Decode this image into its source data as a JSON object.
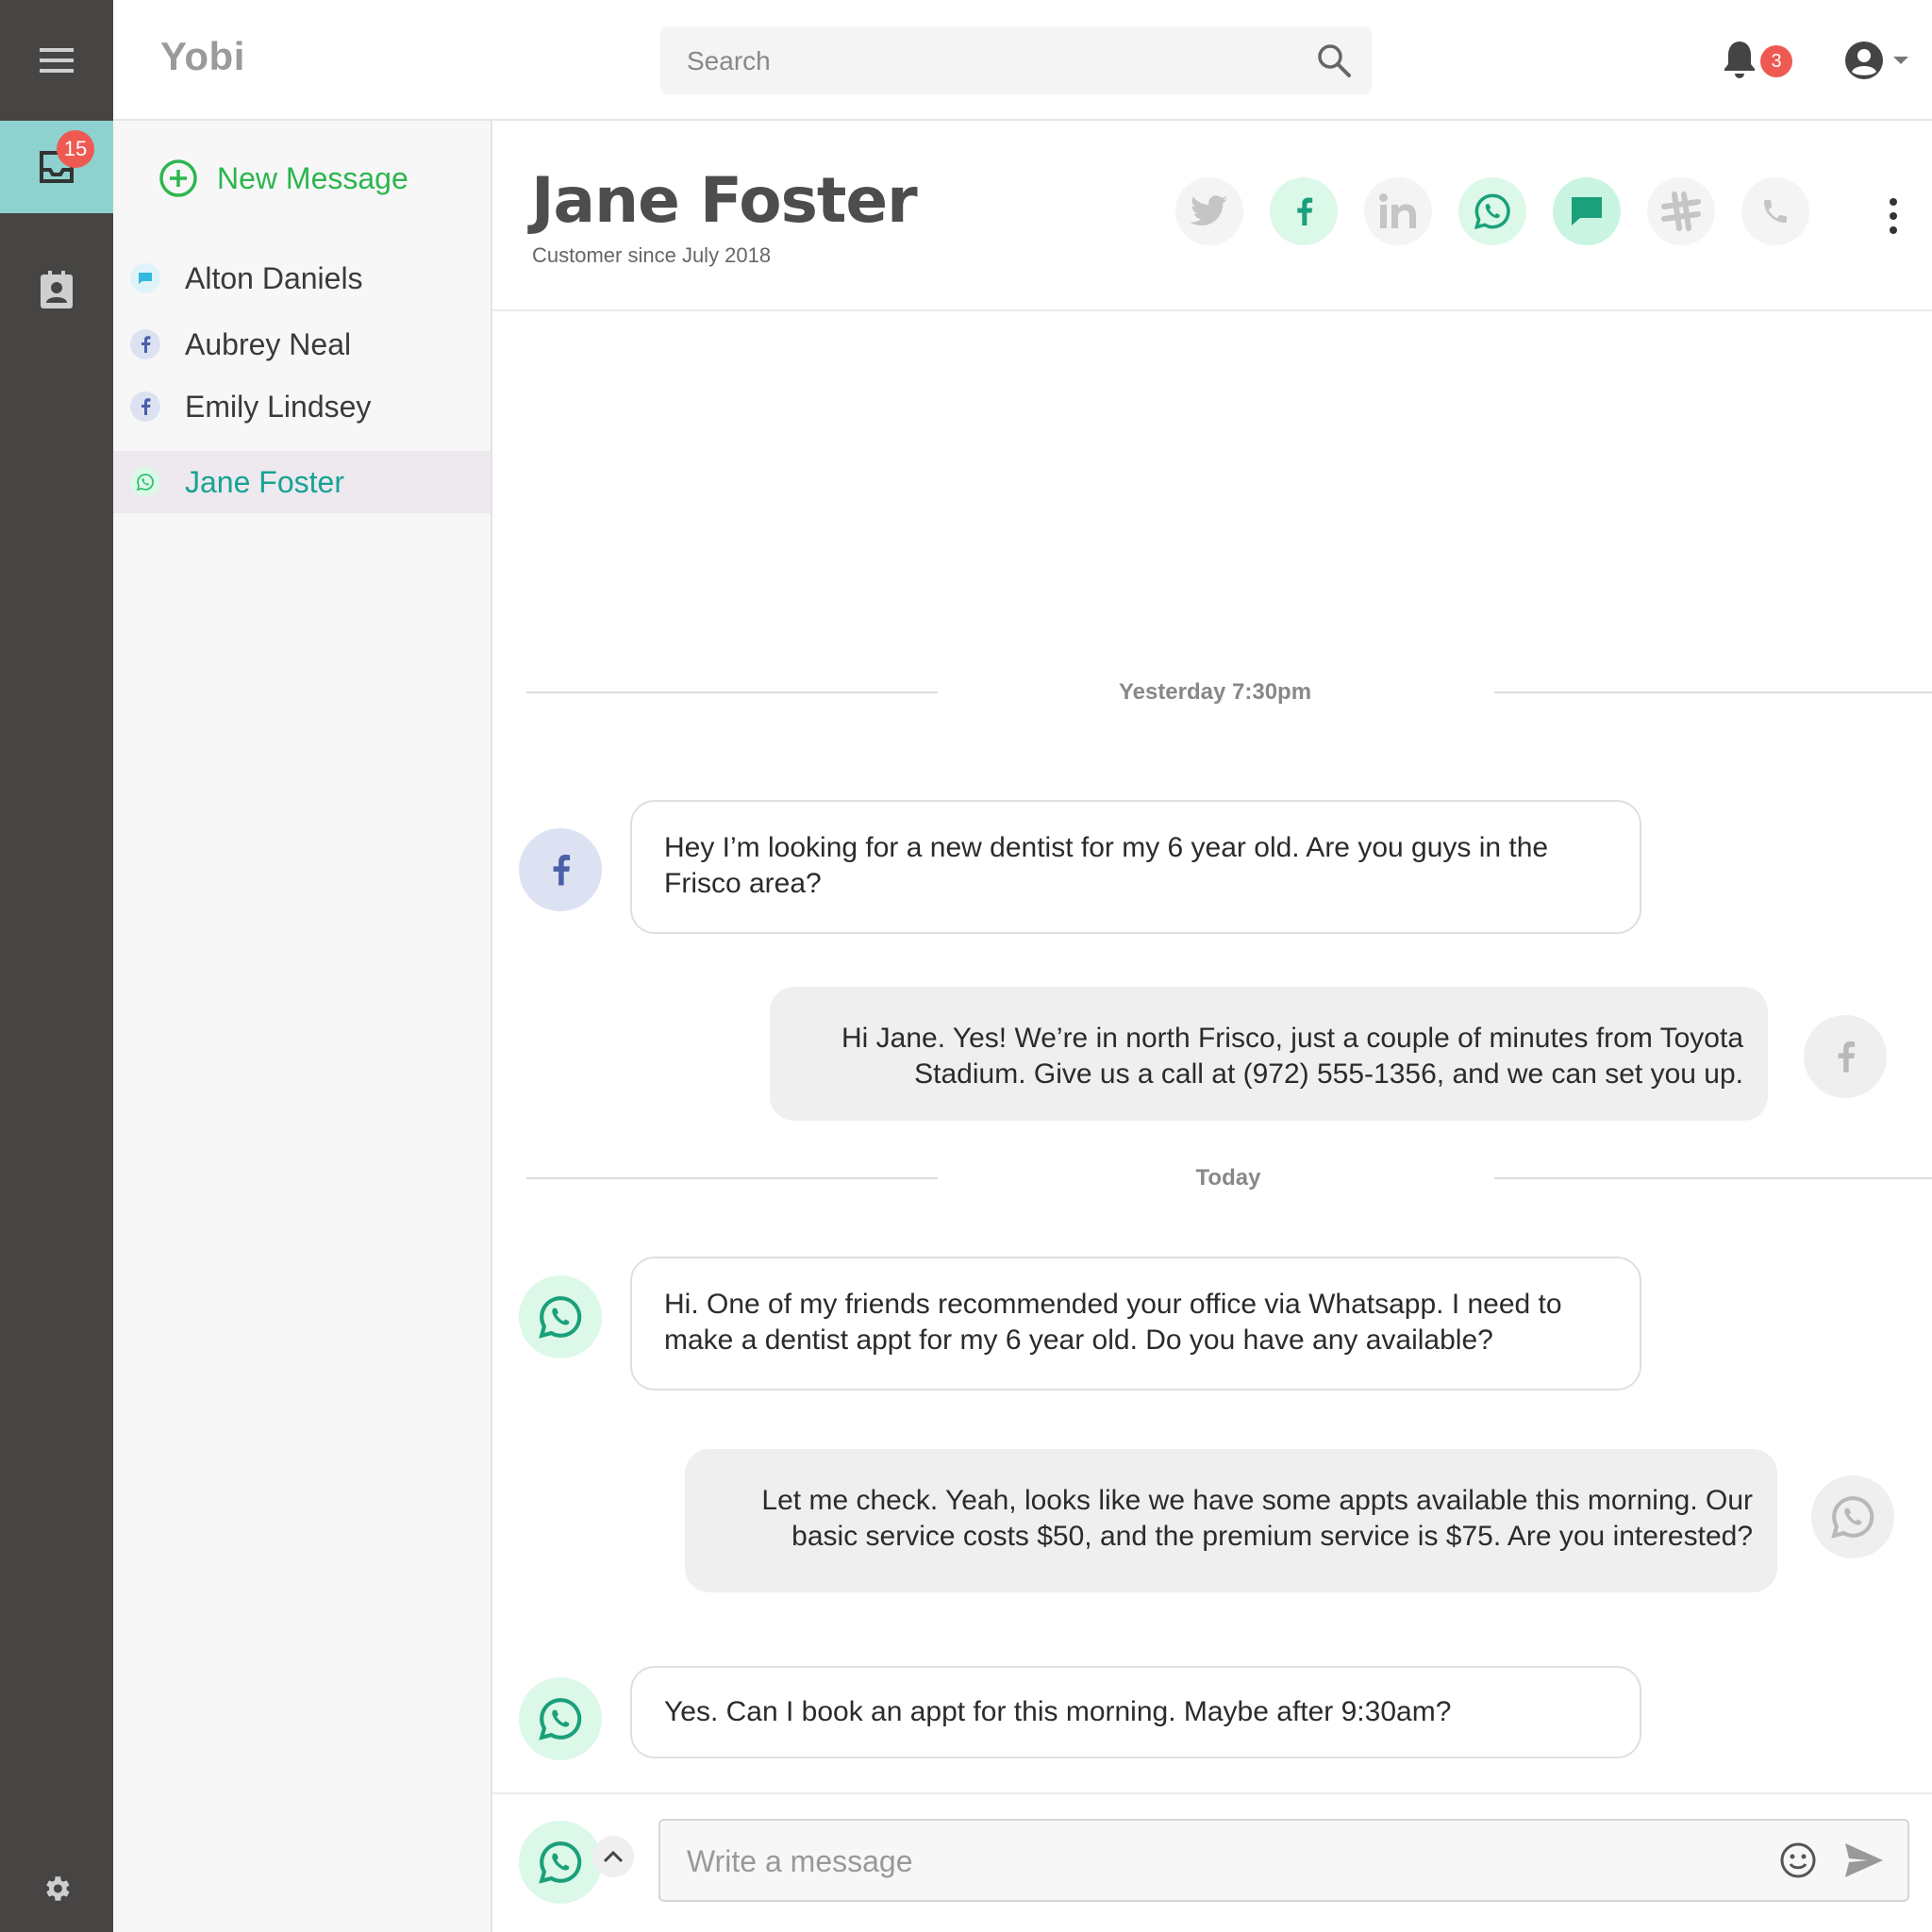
{
  "app": {
    "logo": "Yobi"
  },
  "rail": {
    "inbox_badge": "15"
  },
  "search": {
    "placeholder": "Search"
  },
  "notifications": {
    "badge": "3"
  },
  "sidebar": {
    "new_message": "New Message",
    "conversations": [
      {
        "name": "Alton Daniels",
        "channel": "sms"
      },
      {
        "name": "Aubrey Neal",
        "channel": "facebook"
      },
      {
        "name": "Emily Lindsey",
        "channel": "facebook"
      },
      {
        "name": "Jane Foster",
        "channel": "whatsapp",
        "active": true
      }
    ]
  },
  "contact": {
    "name": "Jane Foster",
    "since": "Customer since July 2018",
    "channels": [
      "twitter",
      "facebook",
      "linkedin",
      "whatsapp",
      "sms",
      "slack",
      "phone"
    ]
  },
  "thread": {
    "separators": [
      "Yesterday 7:30pm",
      "Today"
    ],
    "messages": [
      {
        "direction": "in",
        "channel": "facebook",
        "text": "Hey I’m looking for a new dentist for my 6 year old. Are you guys in the Frisco area?"
      },
      {
        "direction": "out",
        "channel": "facebook",
        "text": "Hi Jane. Yes! We’re in north Frisco, just a couple of minutes from Toyota Stadium. Give us a call at (972) 555-1356, and we can set you up."
      },
      {
        "direction": "in",
        "channel": "whatsapp",
        "text": "Hi. One of my friends recommended your office via Whatsapp.  I need to make a dentist appt for my 6 year old. Do you have any available?"
      },
      {
        "direction": "out",
        "channel": "whatsapp",
        "text": "Let me check. Yeah, looks like we have some appts available this morning. Our basic service costs $50, and the premium service is $75. Are you interested?"
      },
      {
        "direction": "in",
        "channel": "whatsapp",
        "text": "Yes. Can I book an appt for this morning. Maybe after 9:30am?"
      }
    ]
  },
  "composer": {
    "placeholder": "Write a message"
  },
  "colors": {
    "accent_green": "#2cb64e",
    "teal": "#16a394",
    "rail": "#474544",
    "badge_red": "#ee5a52",
    "whatsapp_bg": "#dcf8e8",
    "facebook_bg": "#dde2f3"
  }
}
